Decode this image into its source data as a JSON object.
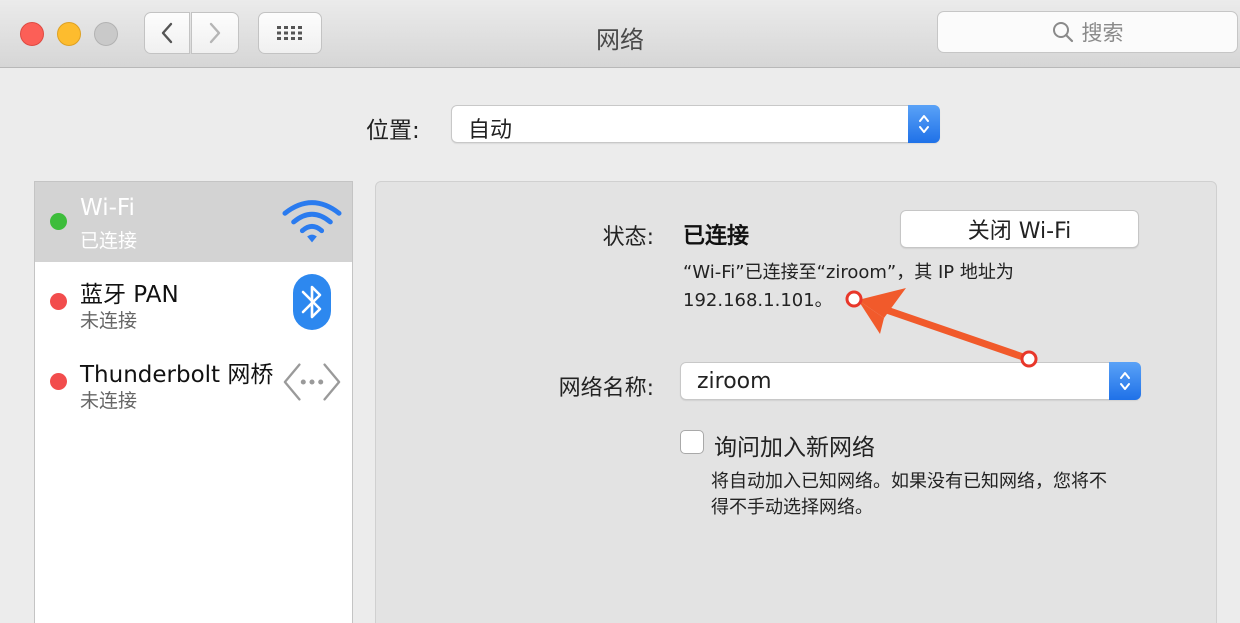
{
  "window": {
    "title": "网络"
  },
  "toolbar": {
    "search_placeholder": "搜索"
  },
  "location": {
    "label": "位置:",
    "value": "自动"
  },
  "services": [
    {
      "name": "Wi-Fi",
      "status": "已连接",
      "status_color": "#3dbd3b",
      "icon": "wifi-icon"
    },
    {
      "name": "蓝牙 PAN",
      "status": "未连接",
      "status_color": "#f24d4d",
      "icon": "bluetooth-icon"
    },
    {
      "name": "Thunderbolt 网桥",
      "status": "未连接",
      "status_color": "#f24d4d",
      "icon": "thunderbolt-bridge-icon"
    }
  ],
  "detail": {
    "status_label": "状态:",
    "status_value": "已连接",
    "turn_off_button": "关闭 Wi-Fi",
    "status_description_line1": "“Wi-Fi”已连接至“ziroom”，其 IP 地址为",
    "status_description_line2": "192.168.1.101。",
    "network_name_label": "网络名称:",
    "network_name_value": "ziroom",
    "ask_join_label": "询问加入新网络",
    "ask_join_checked": false,
    "ask_join_description_line1": "将自动加入已知网络。如果没有已知网络，您将不",
    "ask_join_description_line2": "得不手动选择网络。"
  },
  "colors": {
    "accent": "#2a7bef",
    "annotation": "#f15a2b"
  }
}
